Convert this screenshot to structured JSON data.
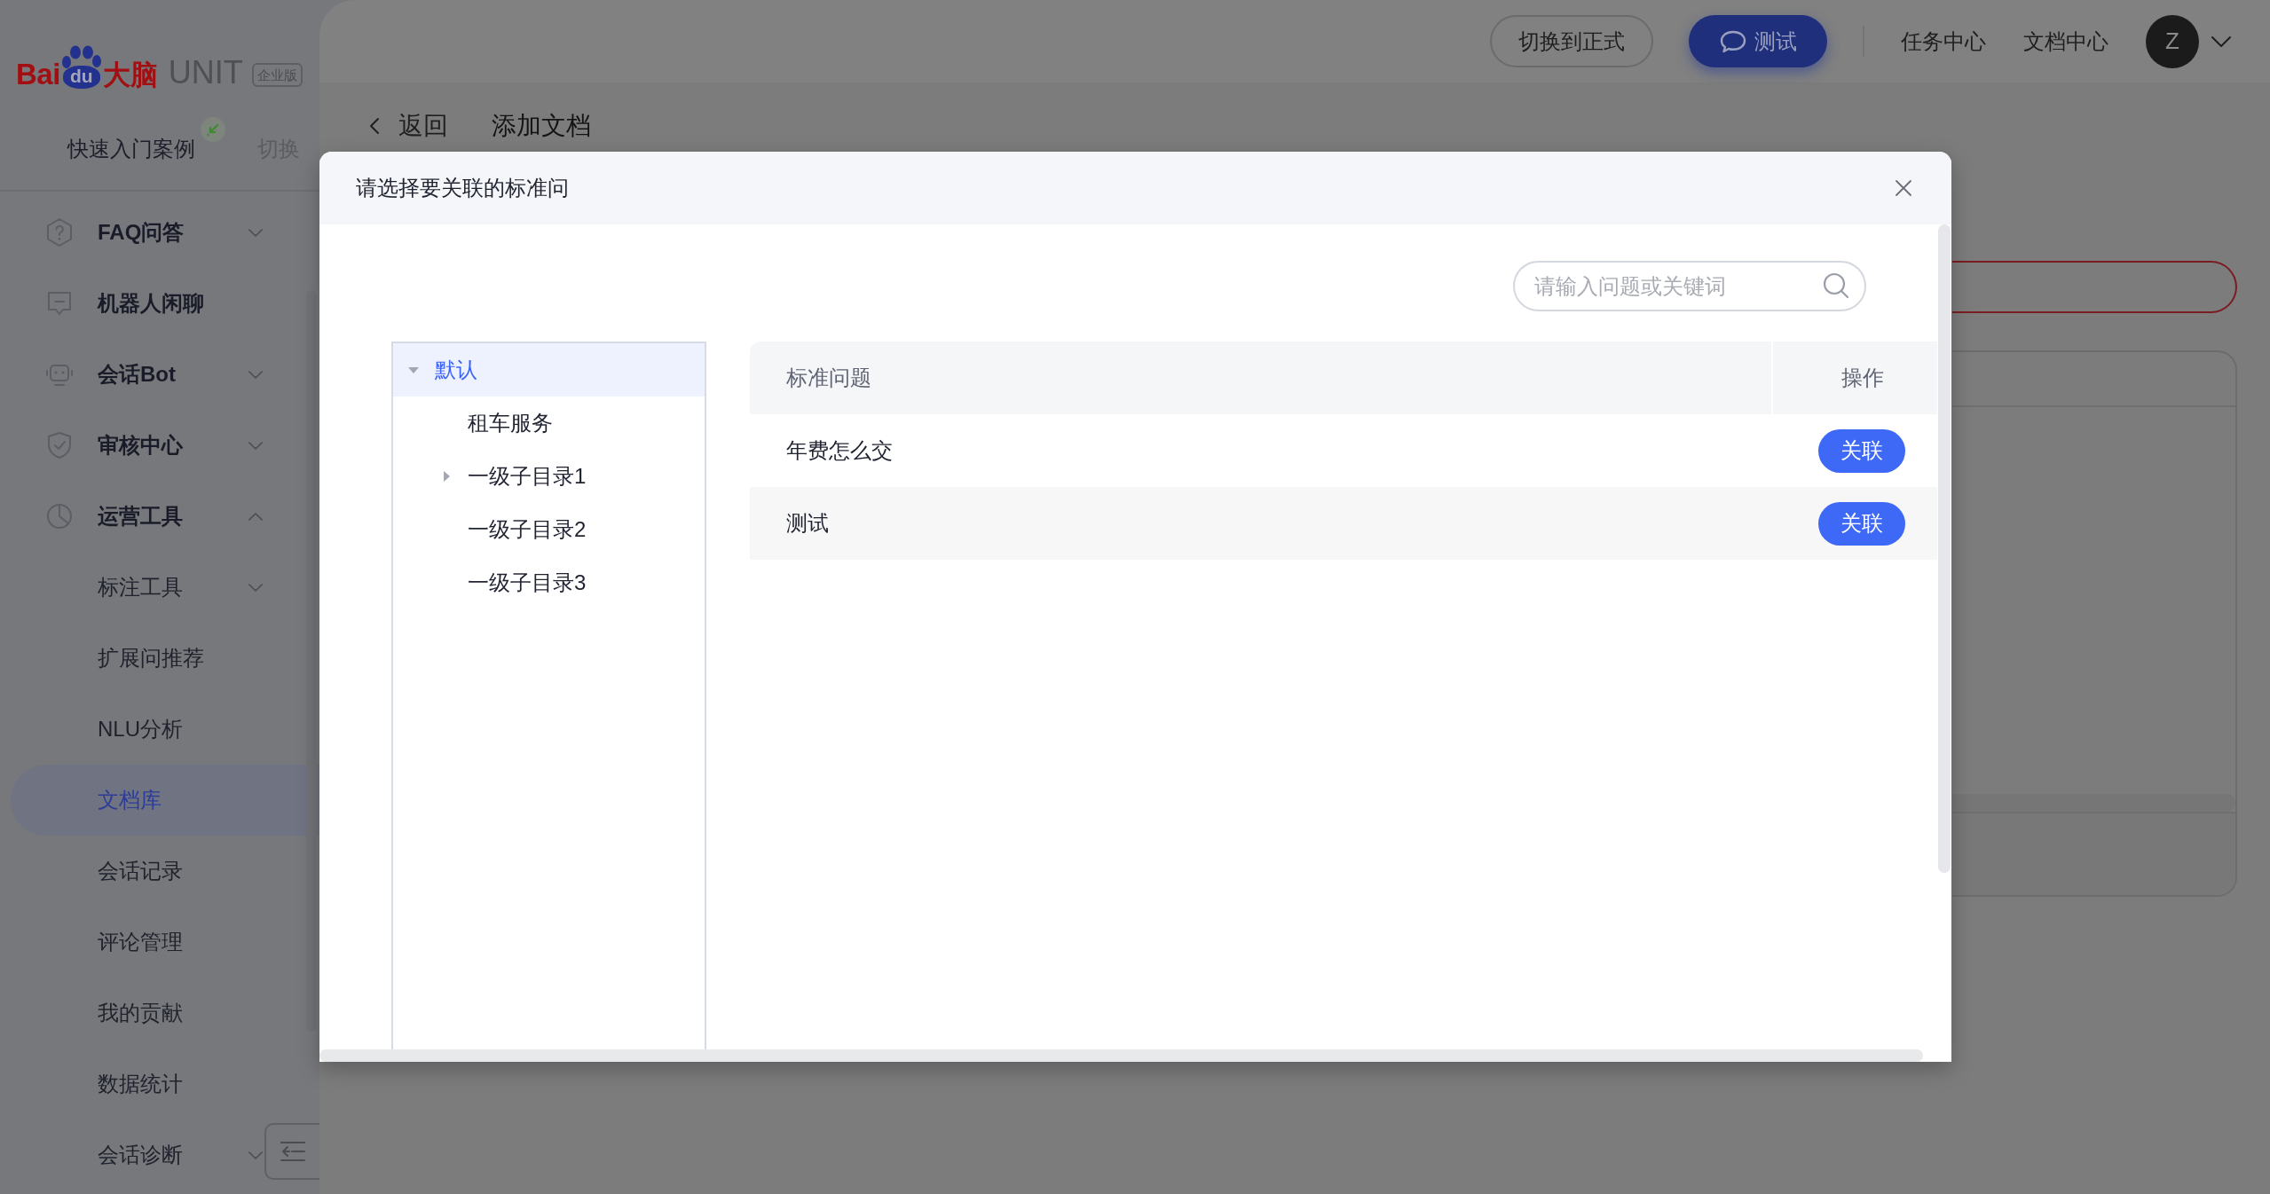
{
  "logo": {
    "brand": "Bai",
    "paw_text": "du",
    "product_cn": "大脑",
    "product": "UNIT",
    "edition": "企业版"
  },
  "sidebar": {
    "project": {
      "label": "快速入门案例",
      "switch": "切换"
    },
    "items": [
      {
        "label": "FAQ问答",
        "kind": "group",
        "expanded": false,
        "selected": false
      },
      {
        "label": "机器人闲聊",
        "kind": "link",
        "selected": false
      },
      {
        "label": "会话Bot",
        "kind": "group",
        "expanded": false,
        "selected": false
      },
      {
        "label": "审核中心",
        "kind": "group",
        "expanded": false,
        "selected": false
      },
      {
        "label": "运营工具",
        "kind": "group",
        "expanded": true,
        "selected": false,
        "children": [
          {
            "label": "标注工具",
            "kind": "group",
            "expanded": false,
            "selected": false
          },
          {
            "label": "扩展问推荐",
            "kind": "link",
            "selected": false
          },
          {
            "label": "NLU分析",
            "kind": "link",
            "selected": false
          },
          {
            "label": "文档库",
            "kind": "link",
            "selected": true
          },
          {
            "label": "会话记录",
            "kind": "link",
            "selected": false
          },
          {
            "label": "评论管理",
            "kind": "link",
            "selected": false
          },
          {
            "label": "我的贡献",
            "kind": "link",
            "selected": false
          },
          {
            "label": "数据统计",
            "kind": "link",
            "selected": false
          },
          {
            "label": "会话诊断",
            "kind": "group",
            "expanded": false,
            "selected": false
          }
        ]
      }
    ]
  },
  "header": {
    "buttons": [
      {
        "label": "切换到正式",
        "kind": "outline"
      },
      {
        "label": "测试",
        "kind": "primary"
      }
    ],
    "links": [
      "任务中心",
      "文档中心"
    ],
    "avatar": "Z"
  },
  "breadcrumb": {
    "back": "返回",
    "title": "添加文档"
  },
  "dialog": {
    "title": "请选择要关联的标准问",
    "search": {
      "placeholder": "请输入问题或关键词"
    },
    "tree": [
      {
        "label": "默认",
        "kind": "branch",
        "expanded": true,
        "selected": true,
        "children": [
          {
            "label": "租车服务",
            "kind": "leaf",
            "selected": false
          },
          {
            "label": "一级子目录1",
            "kind": "branch",
            "expanded": false,
            "selected": false
          },
          {
            "label": "一级子目录2",
            "kind": "leaf",
            "selected": false
          },
          {
            "label": "一级子目录3",
            "kind": "leaf",
            "selected": false
          }
        ]
      }
    ],
    "table": {
      "columns": [
        "标准问题",
        "操作"
      ],
      "rows": [
        {
          "question": "年费怎么交",
          "action": "关联"
        },
        {
          "question": "测试",
          "action": "关联"
        }
      ]
    }
  }
}
